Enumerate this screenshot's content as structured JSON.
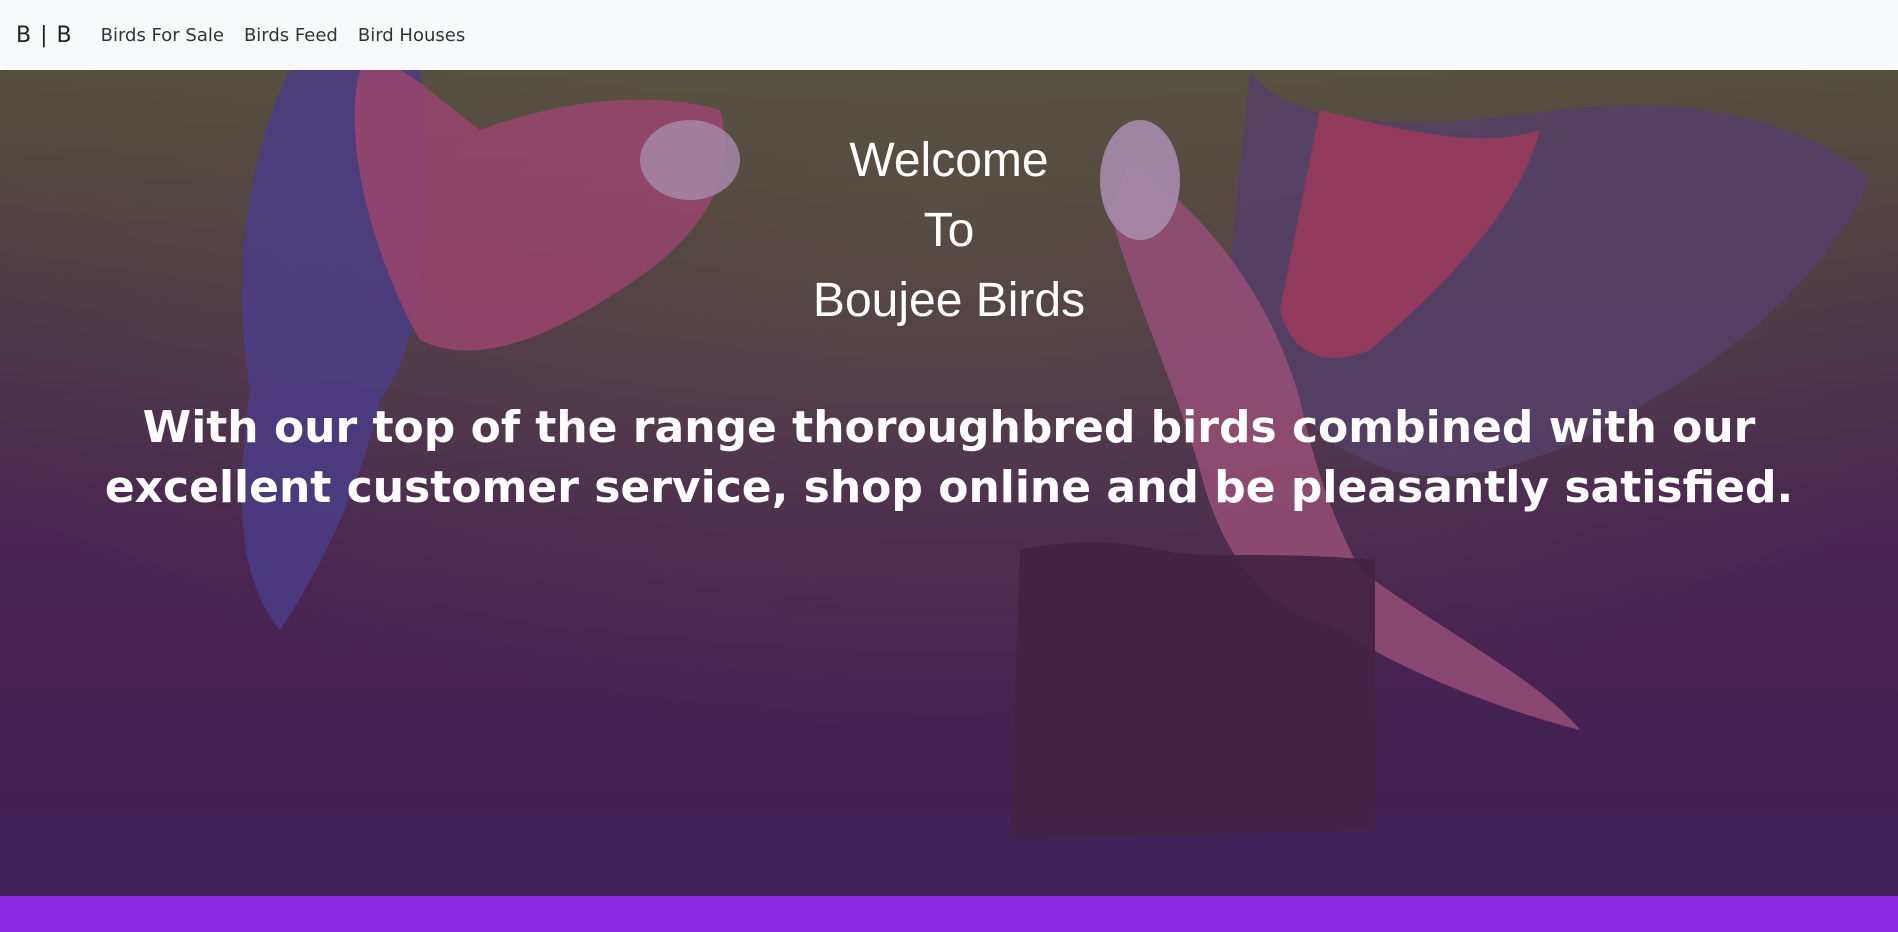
{
  "navbar": {
    "brand": "B | B",
    "links": [
      "Birds For Sale",
      "Birds Feed",
      "Bird Houses"
    ]
  },
  "hero": {
    "welcome_lines": [
      "Welcome",
      "To",
      "Boujee Birds"
    ],
    "tagline": "With our top of the range thoroughbred birds combined with our excellent customer service, shop online and be pleasantly satisfied.",
    "background_image": "two-galah-cockatoos-over-water",
    "overlay_color": "#4a1e5a"
  },
  "footer": {
    "color": "#8a2be2"
  }
}
